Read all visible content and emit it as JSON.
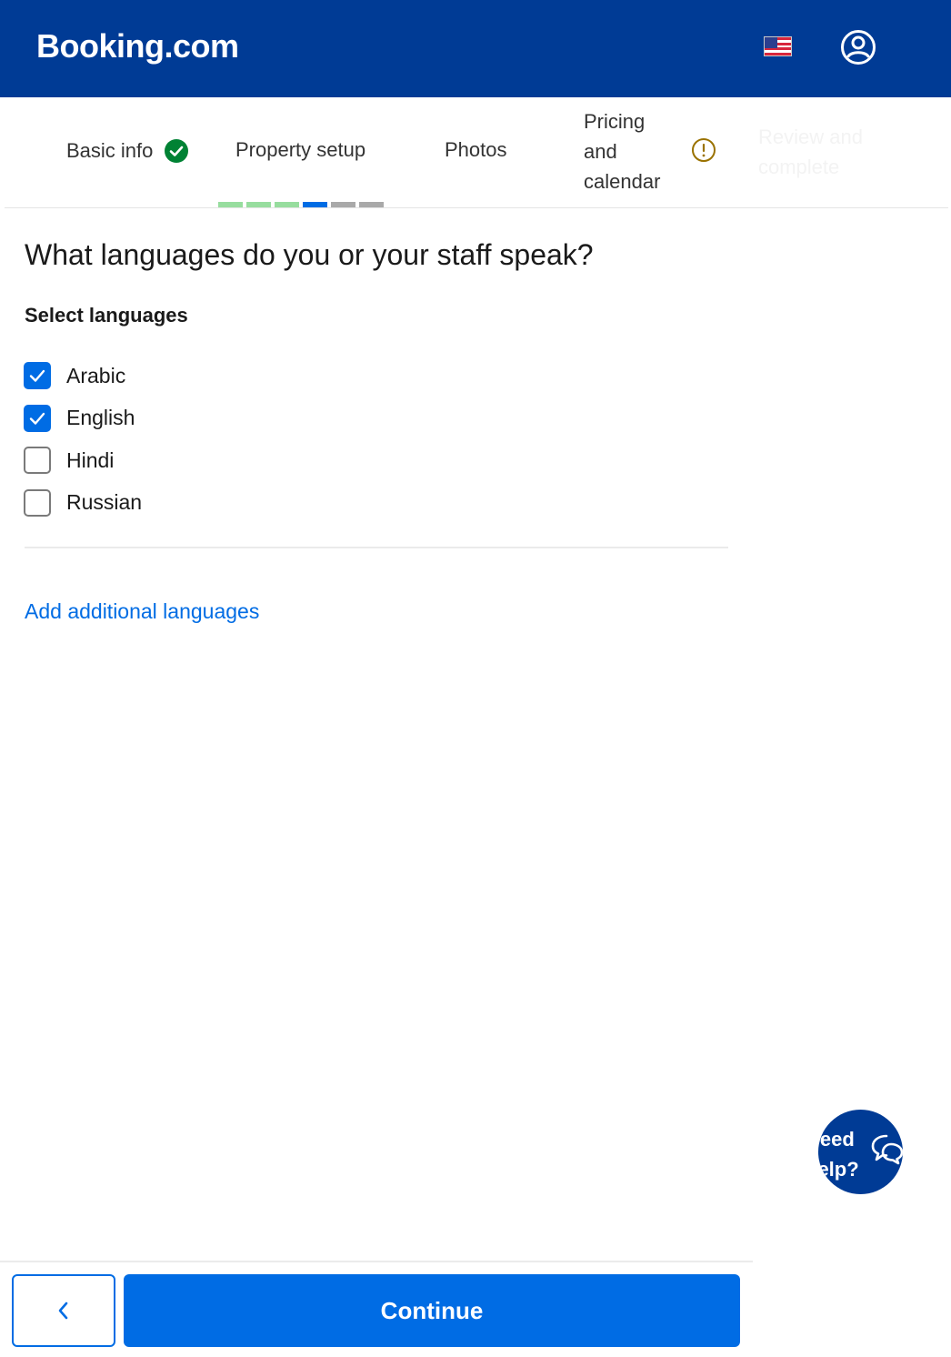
{
  "header": {
    "logo": "Booking.com",
    "flag_icon": "us-flag-icon",
    "account_icon": "user-circle-icon",
    "brand_color": "#003b95"
  },
  "steps": [
    {
      "label": "Basic info",
      "status": "complete"
    },
    {
      "label": "Property setup",
      "status": "current"
    },
    {
      "label": "Photos",
      "status": "pending"
    },
    {
      "label": "Pricing and calendar",
      "status": "warning"
    },
    {
      "label": "Review and complete",
      "status": "disabled"
    }
  ],
  "progress": {
    "segments": [
      "done",
      "done",
      "done",
      "current",
      "todo",
      "todo"
    ],
    "colors": {
      "done": "#97dd9e",
      "current": "#006ce4",
      "todo": "#a9a9a9"
    }
  },
  "main": {
    "question": "What languages do you or your staff speak?",
    "section_label": "Select languages",
    "languages": [
      {
        "label": "Arabic",
        "checked": true
      },
      {
        "label": "English",
        "checked": true
      },
      {
        "label": "Hindi",
        "checked": false
      },
      {
        "label": "Russian",
        "checked": false
      }
    ],
    "add_link": "Add additional languages"
  },
  "help": {
    "line1": "Need",
    "line2": "help?",
    "icon": "chat-bubbles-icon"
  },
  "footer": {
    "back_icon": "chevron-left-icon",
    "continue_label": "Continue",
    "accent_color": "#006ce4"
  }
}
